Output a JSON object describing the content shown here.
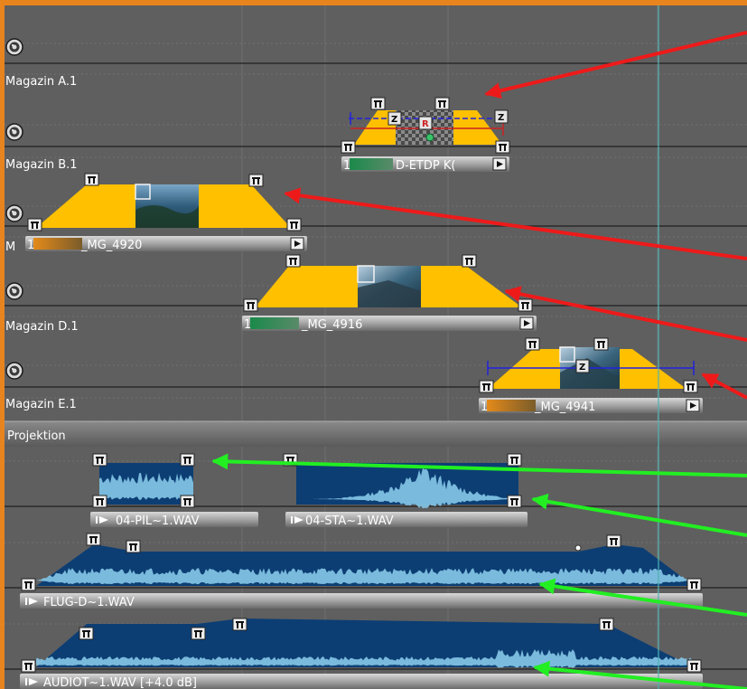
{
  "colors": {
    "frame_border": "#e8841e",
    "background": "#5f5f5f",
    "fade_fill": "#ffc000",
    "audio_dark": "#0c3e74",
    "audio_light": "#86c8e8",
    "arrow_red": "#ee1a1a",
    "arrow_green": "#22ee22",
    "cursor_line": "#4fb4b4"
  },
  "tracks": [
    {
      "label": "Magazin A.1",
      "icon": "speaker-icon"
    },
    {
      "label": "Magazin B.1",
      "icon": "speaker-icon"
    },
    {
      "label": "M",
      "icon": "speaker-icon"
    },
    {
      "label": "Magazin D.1",
      "icon": "speaker-icon"
    },
    {
      "label": "Magazin E.1",
      "icon": "speaker-icon"
    }
  ],
  "projection_header": "Projektion",
  "image_clips": [
    {
      "label": "D-ETDP K(",
      "prefix": "1"
    },
    {
      "label": "_MG_4920",
      "prefix": "1"
    },
    {
      "label": "_MG_4916",
      "prefix": "1"
    },
    {
      "label": "_MG_4941",
      "prefix": "1"
    }
  ],
  "audio_clips": [
    {
      "label": "04-PIL~1.WAV"
    },
    {
      "label": "04-STA~1.WAV"
    },
    {
      "label": "FLUG-D~1.WAV"
    },
    {
      "label": "AUDIOT~1.WAV [+4.0 dB]"
    }
  ],
  "markers": {
    "z": "Z",
    "r": "R"
  },
  "icons": [
    "speaker-icon",
    "play-icon",
    "expand-icon",
    "fade-handle-icon",
    "node-icon"
  ]
}
